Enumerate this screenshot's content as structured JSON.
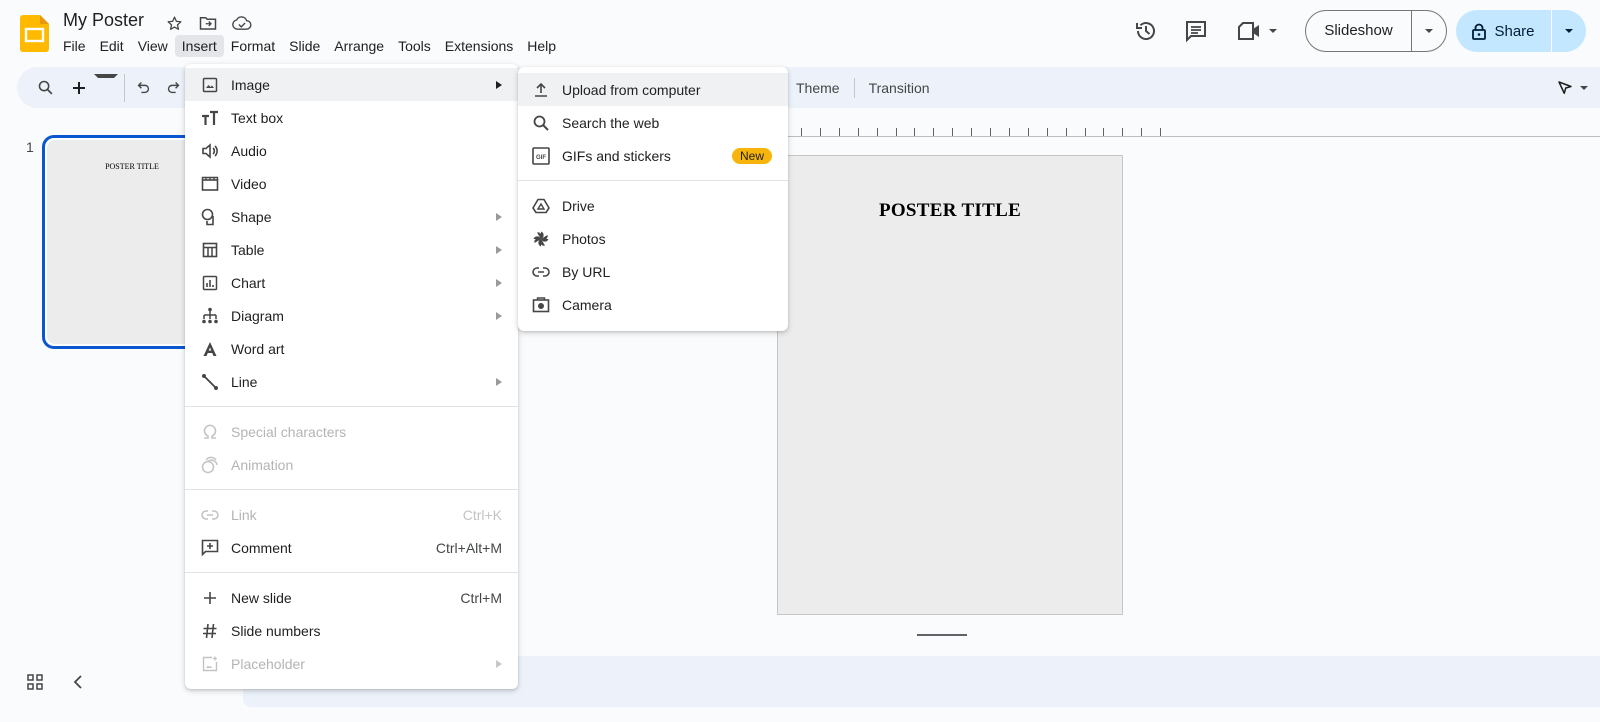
{
  "header": {
    "doc_title": "My Poster",
    "menu": [
      "File",
      "Edit",
      "View",
      "Insert",
      "Format",
      "Slide",
      "Arrange",
      "Tools",
      "Extensions",
      "Help"
    ],
    "active_menu": "Insert",
    "slideshow_label": "Slideshow",
    "share_label": "Share"
  },
  "toolbar": {
    "theme_label": "Theme",
    "transition_label": "Transition"
  },
  "filmstrip": {
    "slides": [
      {
        "number": "1",
        "title": "POSTER TITLE"
      }
    ]
  },
  "canvas": {
    "title": "POSTER TITLE"
  },
  "insert_menu": {
    "groups": [
      [
        {
          "label": "Image",
          "icon": "image-icon",
          "submenu": true,
          "highlighted": true
        },
        {
          "label": "Text box",
          "icon": "text-box-icon"
        },
        {
          "label": "Audio",
          "icon": "audio-icon"
        },
        {
          "label": "Video",
          "icon": "video-icon"
        },
        {
          "label": "Shape",
          "icon": "shape-icon",
          "submenu": true
        },
        {
          "label": "Table",
          "icon": "table-icon",
          "submenu": true
        },
        {
          "label": "Chart",
          "icon": "chart-icon",
          "submenu": true
        },
        {
          "label": "Diagram",
          "icon": "diagram-icon",
          "submenu": true
        },
        {
          "label": "Word art",
          "icon": "word-art-icon"
        },
        {
          "label": "Line",
          "icon": "line-icon",
          "submenu": true
        }
      ],
      [
        {
          "label": "Special characters",
          "icon": "omega-icon",
          "disabled": true
        },
        {
          "label": "Animation",
          "icon": "animation-icon",
          "disabled": true
        }
      ],
      [
        {
          "label": "Link",
          "icon": "link-icon",
          "shortcut": "Ctrl+K",
          "disabled": true
        },
        {
          "label": "Comment",
          "icon": "add-comment-icon",
          "shortcut": "Ctrl+Alt+M"
        }
      ],
      [
        {
          "label": "New slide",
          "icon": "plus-icon",
          "shortcut": "Ctrl+M"
        },
        {
          "label": "Slide numbers",
          "icon": "hash-icon"
        },
        {
          "label": "Placeholder",
          "icon": "placeholder-icon",
          "submenu": true,
          "disabled": true
        }
      ]
    ]
  },
  "image_submenu": {
    "groups": [
      [
        {
          "label": "Upload from computer",
          "icon": "upload-icon",
          "highlighted": true
        },
        {
          "label": "Search the web",
          "icon": "search-icon"
        },
        {
          "label": "GIFs and stickers",
          "icon": "gif-icon",
          "badge": "New"
        }
      ],
      [
        {
          "label": "Drive",
          "icon": "drive-icon"
        },
        {
          "label": "Photos",
          "icon": "photos-icon"
        },
        {
          "label": "By URL",
          "icon": "link-icon"
        },
        {
          "label": "Camera",
          "icon": "camera-icon"
        }
      ]
    ]
  },
  "colors": {
    "accent": "#0b57d0",
    "share_bg": "#c2e7ff",
    "toolbar_bg": "#edf2fa",
    "badge_new": "#f7b50c",
    "logo": "#ffba00"
  }
}
